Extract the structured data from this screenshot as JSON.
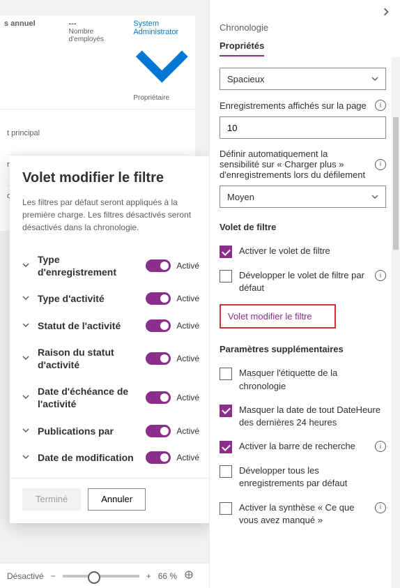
{
  "leftHeader": {
    "col1_top": "s annuel",
    "col2_top": "---",
    "col2_sub": "Nombre d'employés",
    "col3_top": "System Administrator",
    "col3_sub": "Propriétaire"
  },
  "leftBody": {
    "row1": "t principal",
    "row2": "rier électronique",
    "row3": "occionnol"
  },
  "modal": {
    "title": "Volet modifier le filtre",
    "desc": "Les filtres par défaut seront appliqués à la première charge. Les filtres désactivés seront désactivés dans la chronologie.",
    "toggle_on": "Activé",
    "filters": {
      "f0": "Type d'enregistrement",
      "f1": "Type d'activité",
      "f2": "Statut de l'activité",
      "f3": "Raison du statut d'activité",
      "f4": "Date d'échéance de l'activité",
      "f5": "Publications par",
      "f6": "Date de modification"
    },
    "done": "Terminé",
    "cancel": "Annuler"
  },
  "right": {
    "title": "Chronologie",
    "tab": "Propriétés",
    "dropdown1": "Spacieux",
    "field2_label": "Enregistrements affichés sur la page",
    "field2_value": "10",
    "field3_label": "Définir automatiquement la sensibilité sur « Charger plus » d'enregistrements lors du défilement",
    "dropdown3": "Moyen",
    "section_filter": "Volet de filtre",
    "cb1": "Activer le volet de filtre",
    "cb2": "Développer le volet de filtre par défaut",
    "link": "Volet modifier le filtre",
    "section_extra": "Paramètres supplémentaires",
    "cb3": "Masquer l'étiquette de la chronologie",
    "cb4": "Masquer la date de tout DateHeure des dernières 24 heures",
    "cb5": "Activer la barre de recherche",
    "cb6": "Développer tous les enregistrements par défaut",
    "cb7": "Activer la synthèse « Ce que vous avez manqué »"
  },
  "footer": {
    "state": "Désactivé",
    "zoom": "66 %"
  }
}
